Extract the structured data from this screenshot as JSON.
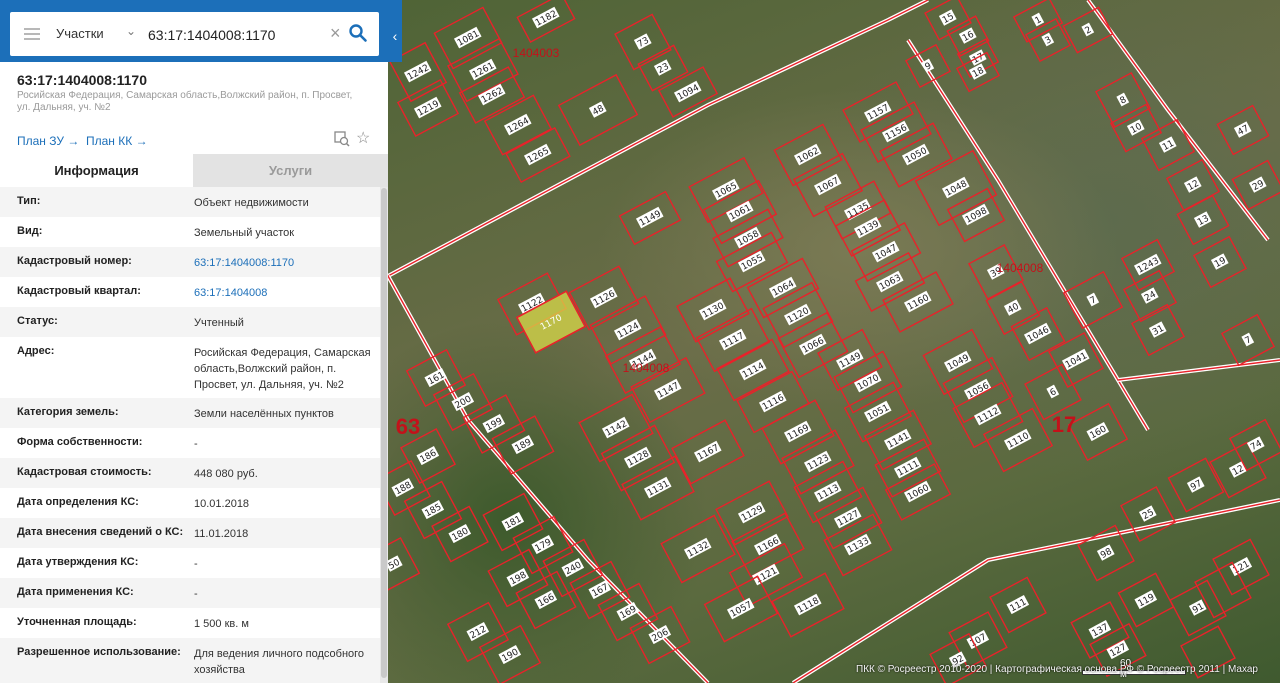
{
  "search": {
    "type_label": "Участки",
    "query": "63:17:1404008:1170"
  },
  "object": {
    "title": "63:17:1404008:1170",
    "address": "Росийская Федерация, Самарская область,Волжский район, п. Просвет, ул. Дальняя, уч. №2",
    "plan_zu": "План ЗУ",
    "plan_kk": "План КК"
  },
  "tabs": {
    "info": "Информация",
    "services": "Услуги"
  },
  "info_rows": [
    {
      "key": "Тип:",
      "value": "Объект недвижимости"
    },
    {
      "key": "Вид:",
      "value": "Земельный участок"
    },
    {
      "key": "Кадастровый номер:",
      "value": "63:17:1404008:1170",
      "link": true
    },
    {
      "key": "Кадастровый квартал:",
      "value": "63:17:1404008",
      "link": true
    },
    {
      "key": "Статус:",
      "value": "Учтенный"
    },
    {
      "key": "Адрес:",
      "value": "Росийская Федерация, Самарская область,Волжский район, п. Просвет, ул. Дальняя, уч. №2"
    },
    {
      "key": "Категория земель:",
      "value": "Земли населённых пунктов"
    },
    {
      "key": "Форма собственности:",
      "value": "-"
    },
    {
      "key": "Кадастровая стоимость:",
      "value": "448 080 руб."
    },
    {
      "key": "Дата определения КС:",
      "value": "10.01.2018"
    },
    {
      "key": "Дата внесения сведений о КС:",
      "value": "11.01.2018"
    },
    {
      "key": "Дата утверждения КС:",
      "value": "-"
    },
    {
      "key": "Дата применения КС:",
      "value": "-"
    },
    {
      "key": "Уточненная площадь:",
      "value": "1 500 кв. м"
    },
    {
      "key": "Разрешенное использование:",
      "value": "Для ведения личного подсобного хозяйства"
    }
  ],
  "map": {
    "scale_label": "60 м",
    "attribution": "ПКК © Росреестр 2010-2020 | Картографическая основа РФ © Росреестр 2011 | Махар",
    "zone_labels": [
      "63",
      "17"
    ],
    "quarter_labels": [
      "1404003",
      "1404008",
      "1404008"
    ],
    "selected_plot": "1170",
    "plot_labels": [
      "1081",
      "1182",
      "1261",
      "1262",
      "1242",
      "1219",
      "1264",
      "1265",
      "48",
      "73",
      "23",
      "1094",
      "15",
      "16",
      "17",
      "18",
      "9",
      "3",
      "1",
      "2",
      "1149",
      "1065",
      "1061",
      "1058",
      "1055",
      "1064",
      "1062",
      "1067",
      "1135",
      "1139",
      "1047",
      "1063",
      "1160",
      "1157",
      "1156",
      "1050",
      "1048",
      "1098",
      "1122",
      "1126",
      "1124",
      "1144",
      "1147",
      "1130",
      "1117",
      "1114",
      "1116",
      "1120",
      "1066",
      "1149",
      "1070",
      "1051",
      "1141",
      "1111",
      "1060",
      "1142",
      "1128",
      "1131",
      "1167",
      "1169",
      "1123",
      "1113",
      "1127",
      "1133",
      "1129",
      "1166",
      "1132",
      "1121",
      "1118",
      "1057",
      "1049",
      "1056",
      "1112",
      "1110",
      "160",
      "161",
      "200",
      "199",
      "189",
      "186",
      "188",
      "185",
      "180",
      "181",
      "179",
      "240",
      "198",
      "166",
      "167",
      "169",
      "206",
      "212",
      "190",
      "50",
      "39",
      "40",
      "1046",
      "1041",
      "6",
      "7",
      "8",
      "10",
      "11",
      "12",
      "13",
      "19",
      "29",
      "47",
      "24",
      "31",
      "1243",
      "7",
      "12",
      "74",
      "97",
      "25",
      "98",
      "119",
      "137",
      "127",
      "111",
      "107",
      "92",
      "91",
      "121"
    ]
  }
}
